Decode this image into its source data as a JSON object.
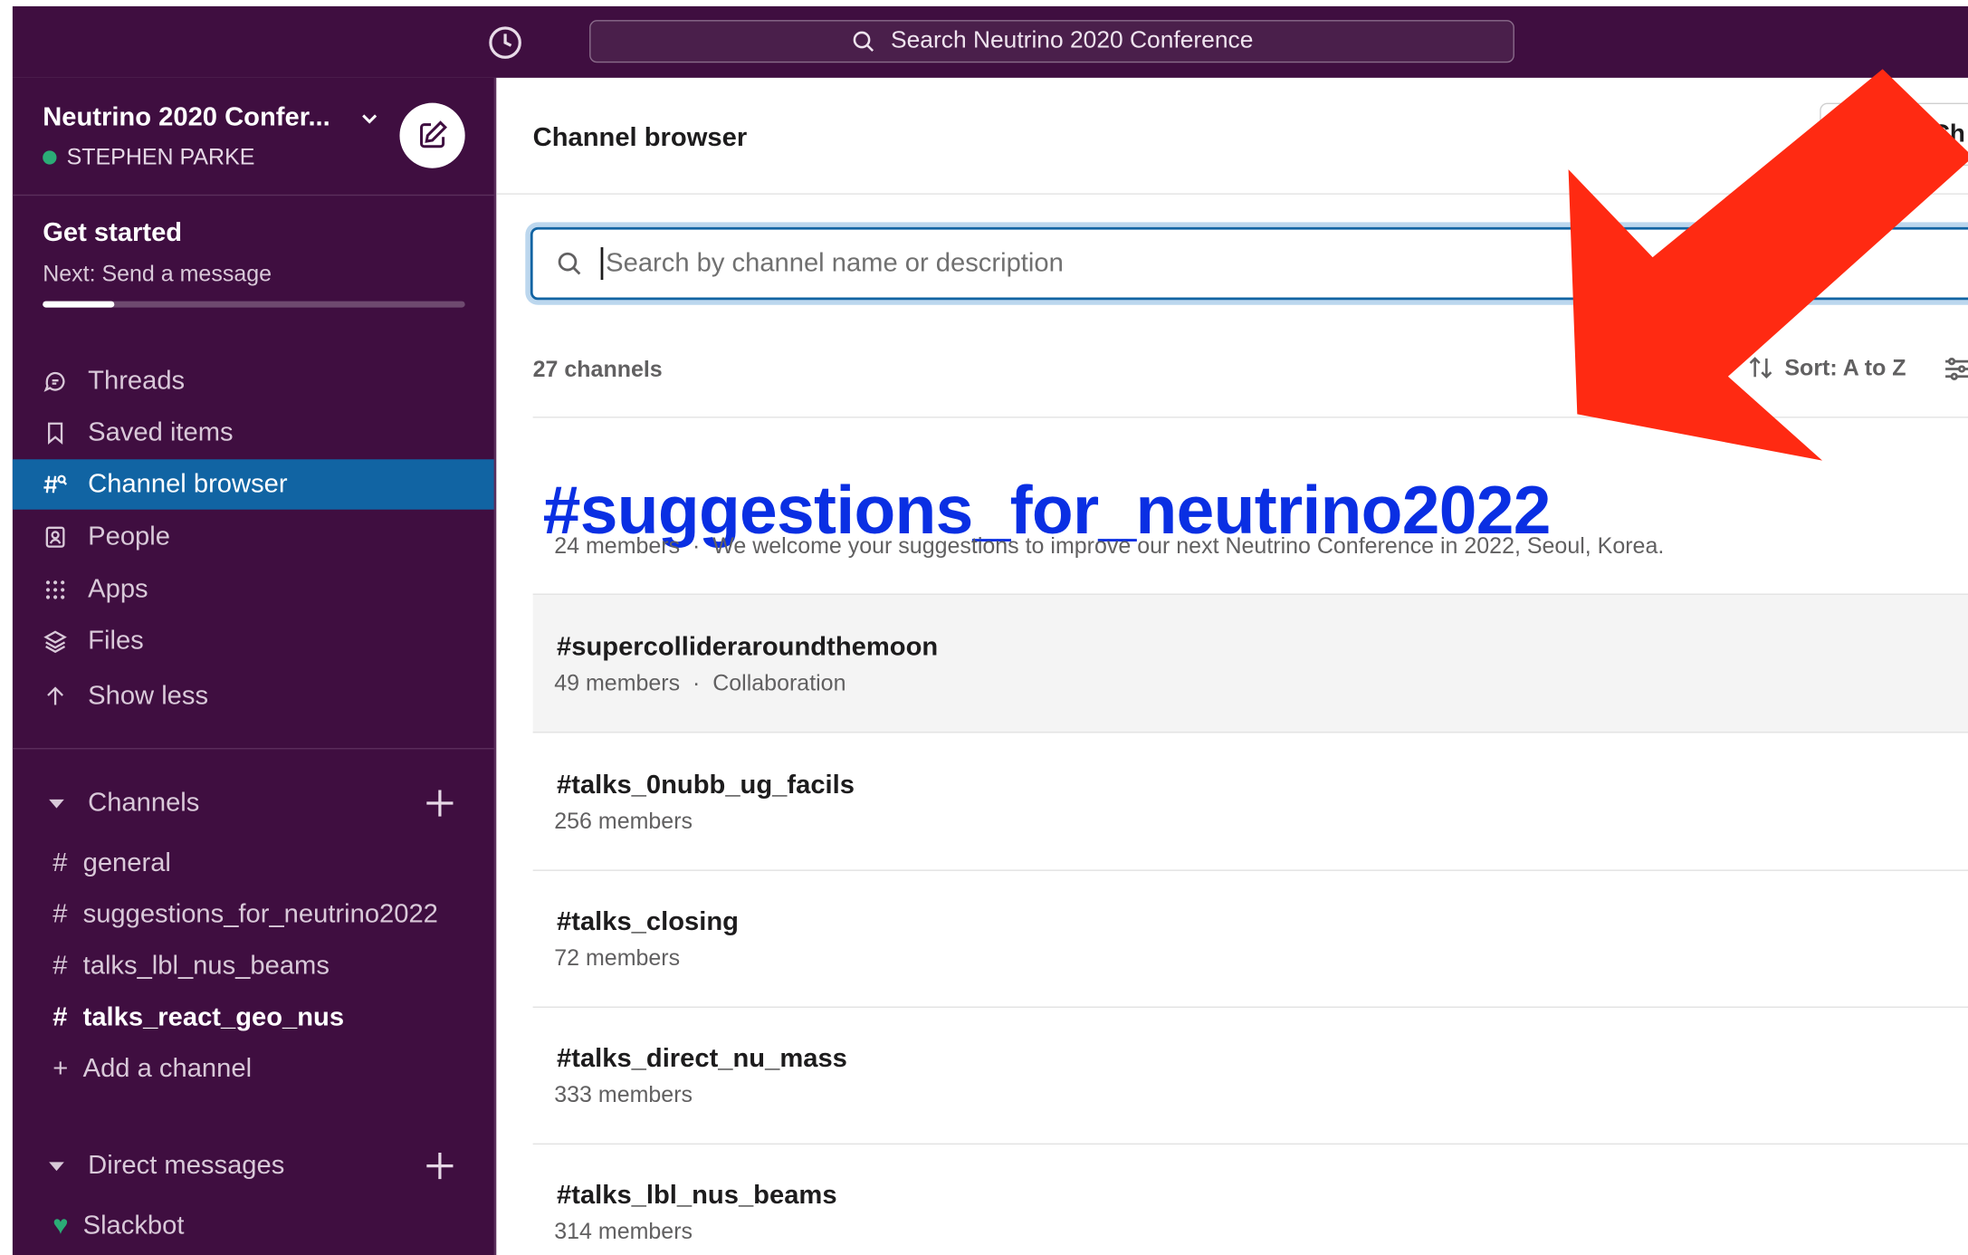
{
  "colors": {
    "sidebar_bg": "#3f0e40",
    "active_item": "#1164a3",
    "presence_green": "#2bac76",
    "annotation_blue": "#0a2fe3",
    "annotation_arrow": "#ff2a12"
  },
  "topbar": {
    "history_icon": "clock-icon",
    "search_label": "Search Neutrino 2020 Conference"
  },
  "workspace": {
    "name": "Neutrino 2020 Confer...",
    "user": "STEPHEN PARKE",
    "compose_icon": "compose-icon"
  },
  "get_started": {
    "title": "Get started",
    "next": "Next: Send a message",
    "progress": 0.17
  },
  "nav": [
    {
      "label": "Threads",
      "icon": "threads-icon"
    },
    {
      "label": "Saved items",
      "icon": "bookmark-icon"
    },
    {
      "label": "Channel browser",
      "icon": "channel-browser-icon"
    },
    {
      "label": "People",
      "icon": "people-icon"
    },
    {
      "label": "Apps",
      "icon": "apps-grid-icon"
    },
    {
      "label": "Files",
      "icon": "files-layers-icon"
    },
    {
      "label": "Show less",
      "icon": "arrow-up-icon"
    }
  ],
  "channels_section": {
    "title": "Channels",
    "items": [
      {
        "label": "general"
      },
      {
        "label": "suggestions_for_neutrino2022"
      },
      {
        "label": "talks_lbl_nus_beams"
      },
      {
        "label": "talks_react_geo_nus"
      }
    ],
    "add_label": "Add a channel"
  },
  "dm_section": {
    "title": "Direct messages",
    "items": [
      {
        "label": "Slackbot"
      }
    ]
  },
  "main": {
    "title": "Channel browser",
    "create_label": "Ch",
    "search_placeholder": "Search by channel name or description",
    "count": "27 channels",
    "sort_label": "Sort: A to Z"
  },
  "channels": [
    {
      "name": "#suggestions_for_neutrino2022",
      "members": "24 members",
      "desc": "We welcome your suggestions to improve our next Neutrino Conference in 2022, Seoul, Korea."
    },
    {
      "name": "#supercollideraroundthemoon",
      "members": "49 members",
      "desc": "Collaboration"
    },
    {
      "name": "#talks_0nubb_ug_facils",
      "members": "256 members",
      "desc": ""
    },
    {
      "name": "#talks_closing",
      "members": "72 members",
      "desc": ""
    },
    {
      "name": "#talks_direct_nu_mass",
      "members": "333 members",
      "desc": ""
    },
    {
      "name": "#talks_lbl_nus_beams",
      "members": "314 members",
      "desc": ""
    }
  ],
  "separator": "·"
}
